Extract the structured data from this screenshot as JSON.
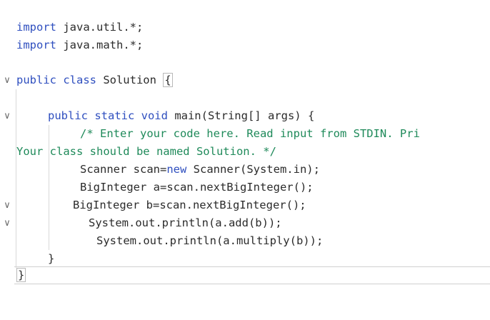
{
  "editor": {
    "lines": {
      "l1": {
        "kw": "import",
        "rest": " java.util.*;"
      },
      "l2": {
        "kw": "import",
        "rest": " java.math.*;"
      },
      "l3": {
        "kw": "public class",
        "name": " Solution ",
        "brace": "{"
      },
      "l4": {
        "kw": "public static void",
        "rest": " main(String[] args) {"
      },
      "l5": {
        "comment": "/* Enter your code here. Read input from STDIN. Pri"
      },
      "l6": {
        "comment": "Your class should be named Solution. */"
      },
      "l7": {
        "plain": "Scanner scan=",
        "kw": "new",
        "rest": " Scanner(System.in);"
      },
      "l8": {
        "text": "BigInteger a=scan.nextBigInteger();"
      },
      "l9": {
        "text": "BigInteger b=scan.nextBigInteger();"
      },
      "l10": {
        "text": "System.out.println(a.add(b));"
      },
      "l11": {
        "text": "System.out.println(a.multiply(b));"
      },
      "l12": {
        "text": "}"
      },
      "l13": {
        "text": "}"
      }
    },
    "fold_icon": "chevron-down-icon",
    "fold_glyph": "∨"
  }
}
